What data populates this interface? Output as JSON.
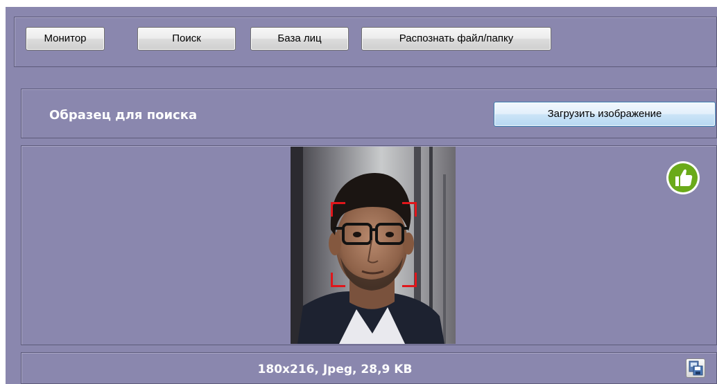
{
  "toolbar": {
    "buttons": [
      {
        "label": "Монитор"
      },
      {
        "label": "Поиск"
      },
      {
        "label": "База лиц"
      },
      {
        "label": "Распознать файл/папку"
      }
    ]
  },
  "search_sample": {
    "title": "Образец для поиска",
    "load_button": "Загрузить изображение"
  },
  "image_info": {
    "text": "180x216, Jpeg, 28,9 KB"
  },
  "icons": {
    "quality": "thumbs-up-icon",
    "save": "save-image-icon"
  },
  "colors": {
    "background": "#8a87ae",
    "quality_ok": "#6aaa1a",
    "face_frame": "#e0161b"
  }
}
